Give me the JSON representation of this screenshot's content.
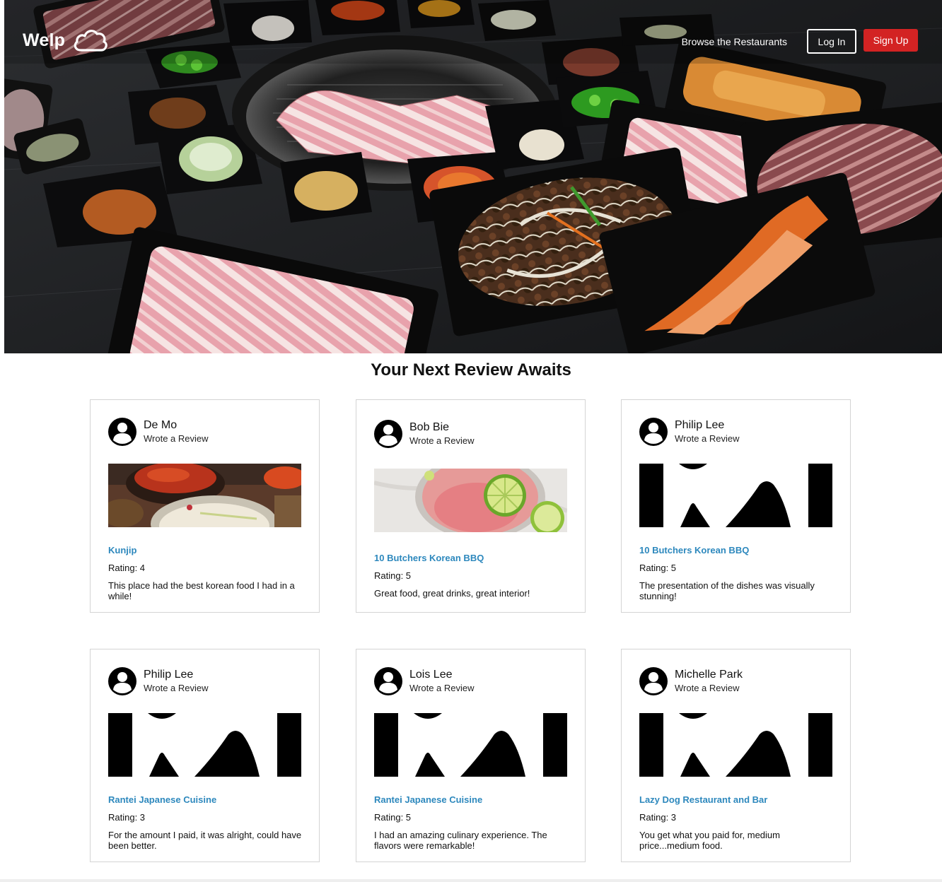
{
  "nav": {
    "logo_text": "Welp",
    "logo_icon": "cloud-icon",
    "browse_label": "Browse the Restaurants",
    "login_label": "Log In",
    "signup_label": "Sign Up"
  },
  "colors": {
    "brand_red": "#d32323",
    "link_blue": "#2d88bd"
  },
  "section": {
    "title": "Your Next Review Awaits"
  },
  "cards": [
    {
      "user": "De Mo",
      "action": "Wrote a Review",
      "photo": "korean-stew-photo",
      "restaurant": "Kunjip",
      "rating": "Rating: 4",
      "text": "This place had the best korean food I had in a while!"
    },
    {
      "user": "Bob Bie",
      "action": "Wrote a Review",
      "photo": "cocktail-photo",
      "restaurant": "10 Butchers Korean BBQ",
      "rating": "Rating: 5",
      "text": "Great food, great drinks, great interior!"
    },
    {
      "user": "Philip Lee",
      "action": "Wrote a Review",
      "photo": "placeholder-image-icon",
      "restaurant": "10 Butchers Korean BBQ",
      "rating": "Rating: 5",
      "text": "The presentation of the dishes was visually stunning!"
    },
    {
      "user": "Philip Lee",
      "action": "Wrote a Review",
      "photo": "placeholder-image-icon",
      "restaurant": "Rantei Japanese Cuisine",
      "rating": "Rating: 3",
      "text": "For the amount I paid, it was alright, could have been better."
    },
    {
      "user": "Lois Lee",
      "action": "Wrote a Review",
      "photo": "placeholder-image-icon",
      "restaurant": "Rantei Japanese Cuisine",
      "rating": "Rating: 5",
      "text": "I had an amazing culinary experience. The flavors were remarkable!"
    },
    {
      "user": "Michelle Park",
      "action": "Wrote a Review",
      "photo": "placeholder-image-icon",
      "restaurant": "Lazy Dog Restaurant and Bar",
      "rating": "Rating: 3",
      "text": "You get what you paid for, medium price...medium food."
    }
  ]
}
